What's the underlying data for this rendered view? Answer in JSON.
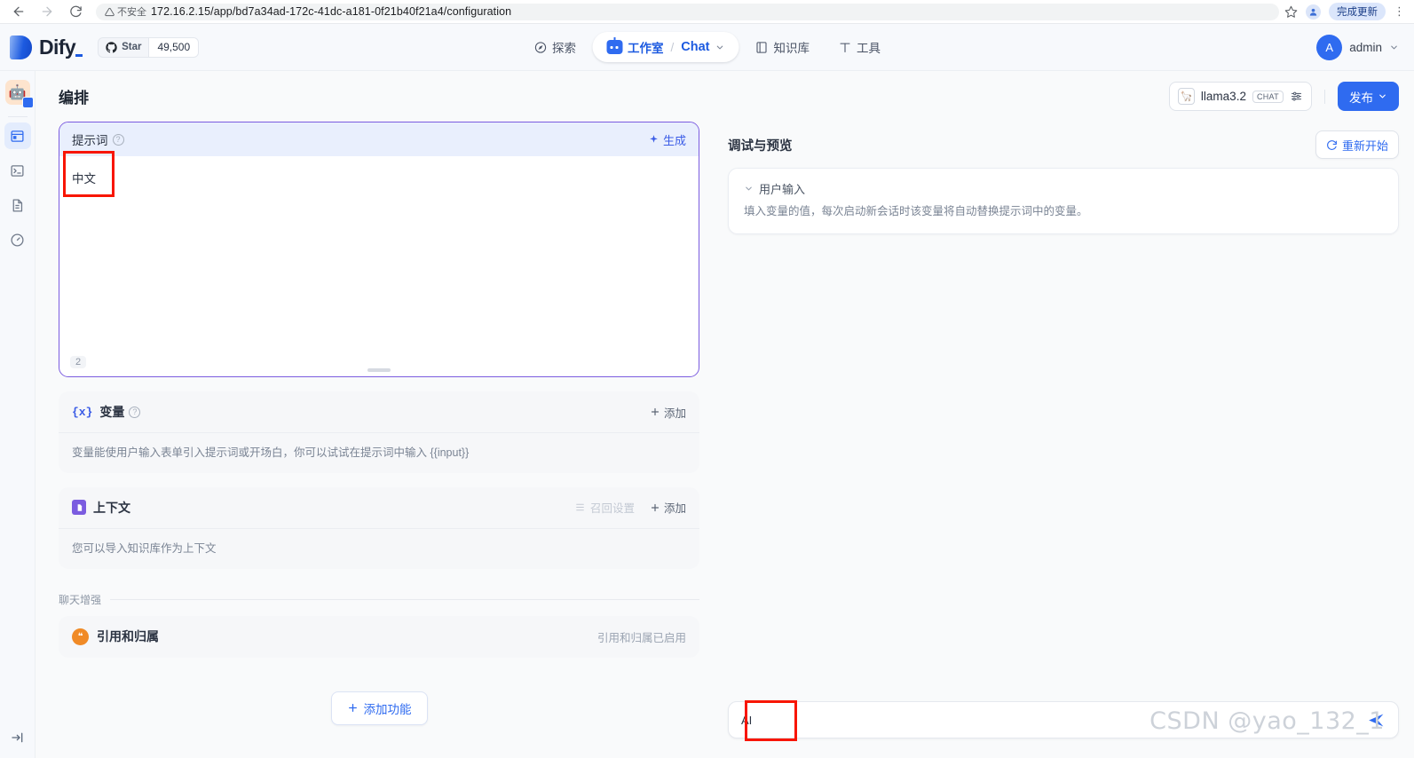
{
  "browser": {
    "back_icon": "arrow-left-icon",
    "forward_icon": "arrow-right-icon",
    "reload_icon": "reload-icon",
    "security_label": "不安全",
    "url": "172.16.2.15/app/bd7a34ad-172c-41dc-a181-0f21b40f21a4/configuration",
    "bookmark_icon": "star-icon",
    "profile_icon": "profile-avatar-icon",
    "update_label": "完成更新",
    "menu_icon": "kebab-menu-icon"
  },
  "header": {
    "brand": "Dify",
    "github": {
      "label": "Star",
      "count": "49,500",
      "icon": "github-icon"
    },
    "nav": [
      {
        "label": "探索",
        "icon": "compass-icon",
        "active": false
      },
      {
        "label": "工作室",
        "icon": "robot-icon",
        "active": true
      },
      {
        "label": "知识库",
        "icon": "book-icon",
        "active": false
      },
      {
        "label": "工具",
        "icon": "tool-icon",
        "active": false
      }
    ],
    "breadcrumb_sep": "/",
    "current_app": "Chat",
    "app_caret": "chevron-down-icon",
    "user": {
      "initial": "A",
      "name": "admin",
      "caret": "chevron-down-icon"
    }
  },
  "rail": {
    "app_avatar_icon": "robot-avatar-icon",
    "app_avatar_glyph": "🤖",
    "items": [
      {
        "name": "orchestrate",
        "icon": "window-icon",
        "active": true
      },
      {
        "name": "api-access",
        "icon": "terminal-icon",
        "active": false
      },
      {
        "name": "logs",
        "icon": "document-icon",
        "active": false
      },
      {
        "name": "monitoring",
        "icon": "gauge-icon",
        "active": false
      }
    ],
    "collapse_icon": "expand-sidebar-icon"
  },
  "page": {
    "title": "编排",
    "model": {
      "icon": "llama-icon",
      "name": "llama3.2",
      "badge": "CHAT",
      "settings_icon": "sliders-icon"
    },
    "publish": {
      "label": "发布",
      "caret": "chevron-down-icon"
    }
  },
  "prompt": {
    "title": "提示词",
    "info_icon": "info-icon",
    "generate": {
      "label": "生成",
      "icon": "sparkle-icon"
    },
    "value": "中文",
    "char_count": "2",
    "drag_handle_icon": "resize-handle-icon"
  },
  "variables": {
    "icon": "variable-icon",
    "icon_glyph": "{x}",
    "title": "变量",
    "info_icon": "info-icon",
    "add": {
      "label": "添加",
      "icon": "plus-icon"
    },
    "description": "变量能使用户输入表单引入提示词或开场白，你可以试试在提示词中输入 {{input}}"
  },
  "context": {
    "icon": "context-file-icon",
    "title": "上下文",
    "recall_settings": {
      "label": "召回设置",
      "icon": "settings-sliders-icon",
      "disabled": true
    },
    "add": {
      "label": "添加",
      "icon": "plus-icon"
    },
    "description": "您可以导入知识库作为上下文"
  },
  "chat_enhance": {
    "divider_label": "聊天增强",
    "feature": {
      "icon": "citation-icon",
      "icon_glyph": "❝",
      "title": "引用和归属",
      "status": "引用和归属已启用"
    }
  },
  "add_feature": {
    "label": "添加功能",
    "icon": "plus-icon"
  },
  "preview": {
    "title": "调试与预览",
    "restart": {
      "label": "重新开始",
      "icon": "refresh-icon"
    },
    "user_input": {
      "caret": "chevron-down-icon",
      "title": "用户输入",
      "description": "填入变量的值，每次启动新会话时该变量将自动替换提示词中的变量。"
    },
    "chat_input": {
      "value": "AI",
      "placeholder": "",
      "send_icon": "send-icon"
    }
  },
  "watermark": "CSDN @yao_132_1",
  "annotations": {
    "prompt_highlight": "red-box-prompt-value",
    "chat_highlight": "red-box-chat-value"
  },
  "colors": {
    "accent": "#2f6bf0",
    "prompt_border": "#7b5ce0",
    "annotation": "#f81500",
    "feature_icon": "#f08a26"
  }
}
